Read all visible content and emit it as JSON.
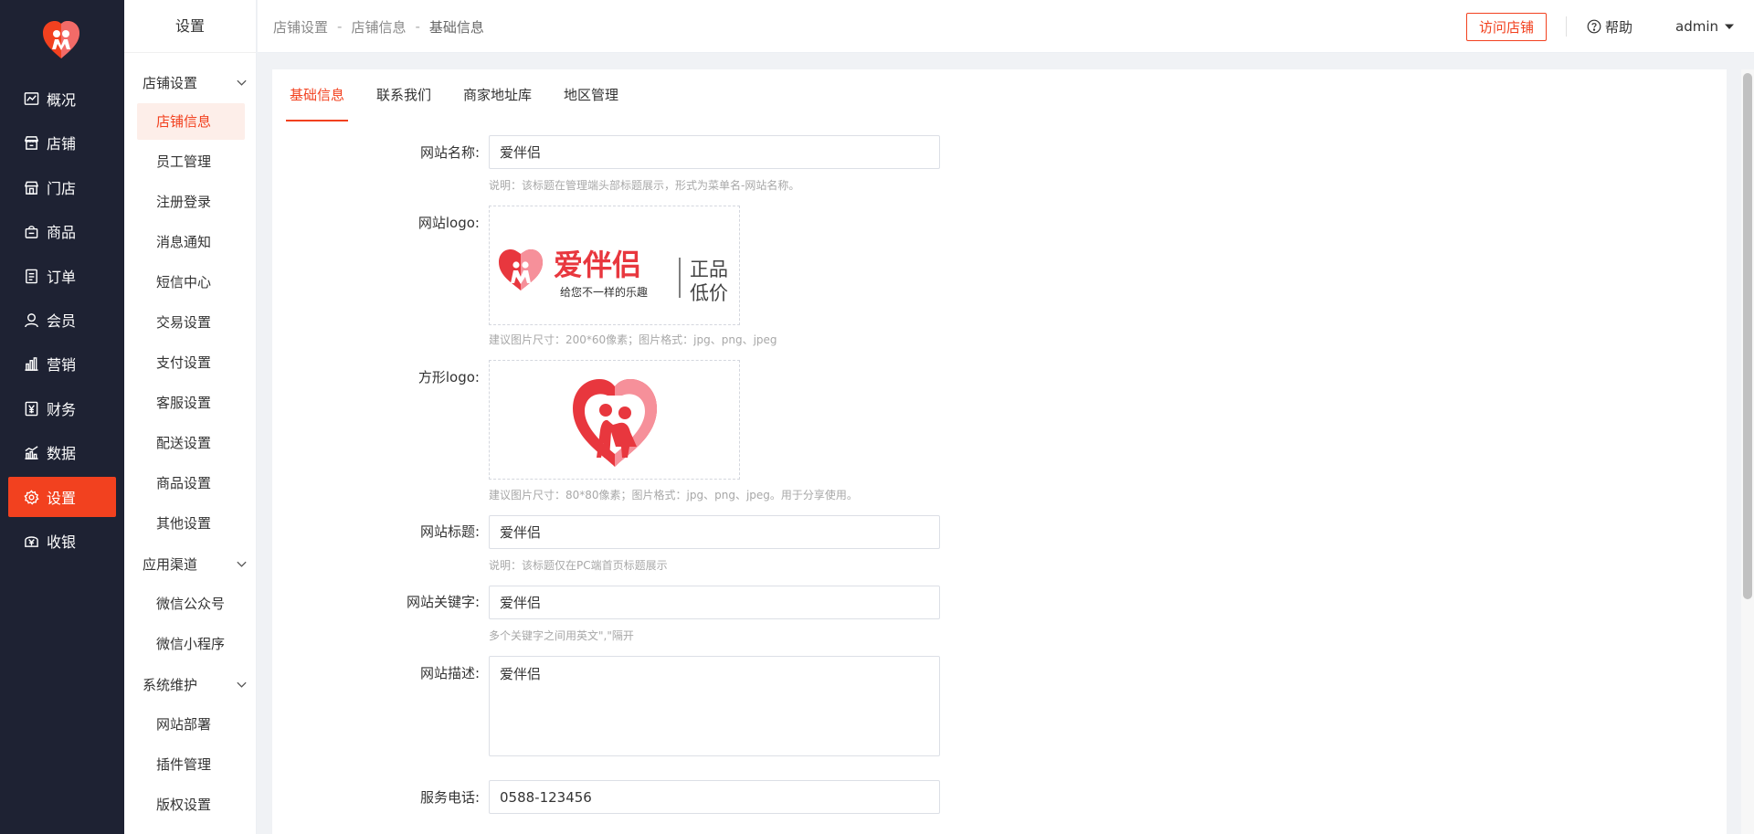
{
  "main_nav": {
    "items": [
      {
        "label": "概况",
        "icon": "chart-icon"
      },
      {
        "label": "店铺",
        "icon": "store-icon"
      },
      {
        "label": "门店",
        "icon": "shop-icon"
      },
      {
        "label": "商品",
        "icon": "bag-icon"
      },
      {
        "label": "订单",
        "icon": "order-icon"
      },
      {
        "label": "会员",
        "icon": "user-icon"
      },
      {
        "label": "营销",
        "icon": "bar-chart-icon"
      },
      {
        "label": "财务",
        "icon": "finance-icon"
      },
      {
        "label": "数据",
        "icon": "data-icon"
      },
      {
        "label": "设置",
        "icon": "gear-icon",
        "active": true
      },
      {
        "label": "收银",
        "icon": "cashier-icon"
      }
    ]
  },
  "sub_nav": {
    "title": "设置",
    "groups": [
      {
        "label": "店铺设置",
        "items": [
          "店铺信息",
          "员工管理",
          "注册登录",
          "消息通知",
          "短信中心",
          "交易设置",
          "支付设置",
          "客服设置",
          "配送设置",
          "商品设置",
          "其他设置"
        ]
      },
      {
        "label": "应用渠道",
        "items": [
          "微信公众号",
          "微信小程序"
        ]
      },
      {
        "label": "系统维护",
        "items": [
          "网站部署",
          "插件管理",
          "版权设置"
        ]
      }
    ],
    "active_item": "店铺信息"
  },
  "header": {
    "breadcrumb": [
      "店铺设置",
      "店铺信息",
      "基础信息"
    ],
    "separator": "-",
    "visit_button": "访问店铺",
    "help": "帮助",
    "user": "admin"
  },
  "tabs": [
    {
      "label": "基础信息",
      "active": true
    },
    {
      "label": "联系我们"
    },
    {
      "label": "商家地址库"
    },
    {
      "label": "地区管理"
    }
  ],
  "form": {
    "site_name": {
      "label": "网站名称:",
      "value": "爱伴侣",
      "help": "说明：该标题在管理端头部标题展示，形式为菜单名-网站名称。"
    },
    "site_logo": {
      "label": "网站logo:",
      "help": "建议图片尺寸：200*60像素；图片格式：jpg、png、jpeg",
      "brand": "爱伴侣",
      "slogan": "给您不一样的乐趣",
      "tag1": "正品",
      "tag2": "低价"
    },
    "square_logo": {
      "label": "方形logo:",
      "help": "建议图片尺寸：80*80像素；图片格式：jpg、png、jpeg。用于分享使用。"
    },
    "site_title": {
      "label": "网站标题:",
      "value": "爱伴侣",
      "help": "说明：该标题仅在PC端首页标题展示"
    },
    "keywords": {
      "label": "网站关键字:",
      "value": "爱伴侣",
      "help": "多个关键字之间用英文\",\"隔开"
    },
    "description": {
      "label": "网站描述:",
      "value": "爱伴侣"
    },
    "phone": {
      "label": "服务电话:",
      "value": "0588-123456"
    }
  },
  "colors": {
    "accent": "#f2411f",
    "nav_bg": "#1e2233",
    "logo_red": "#e8373e",
    "logo_pink": "#f6909a"
  }
}
